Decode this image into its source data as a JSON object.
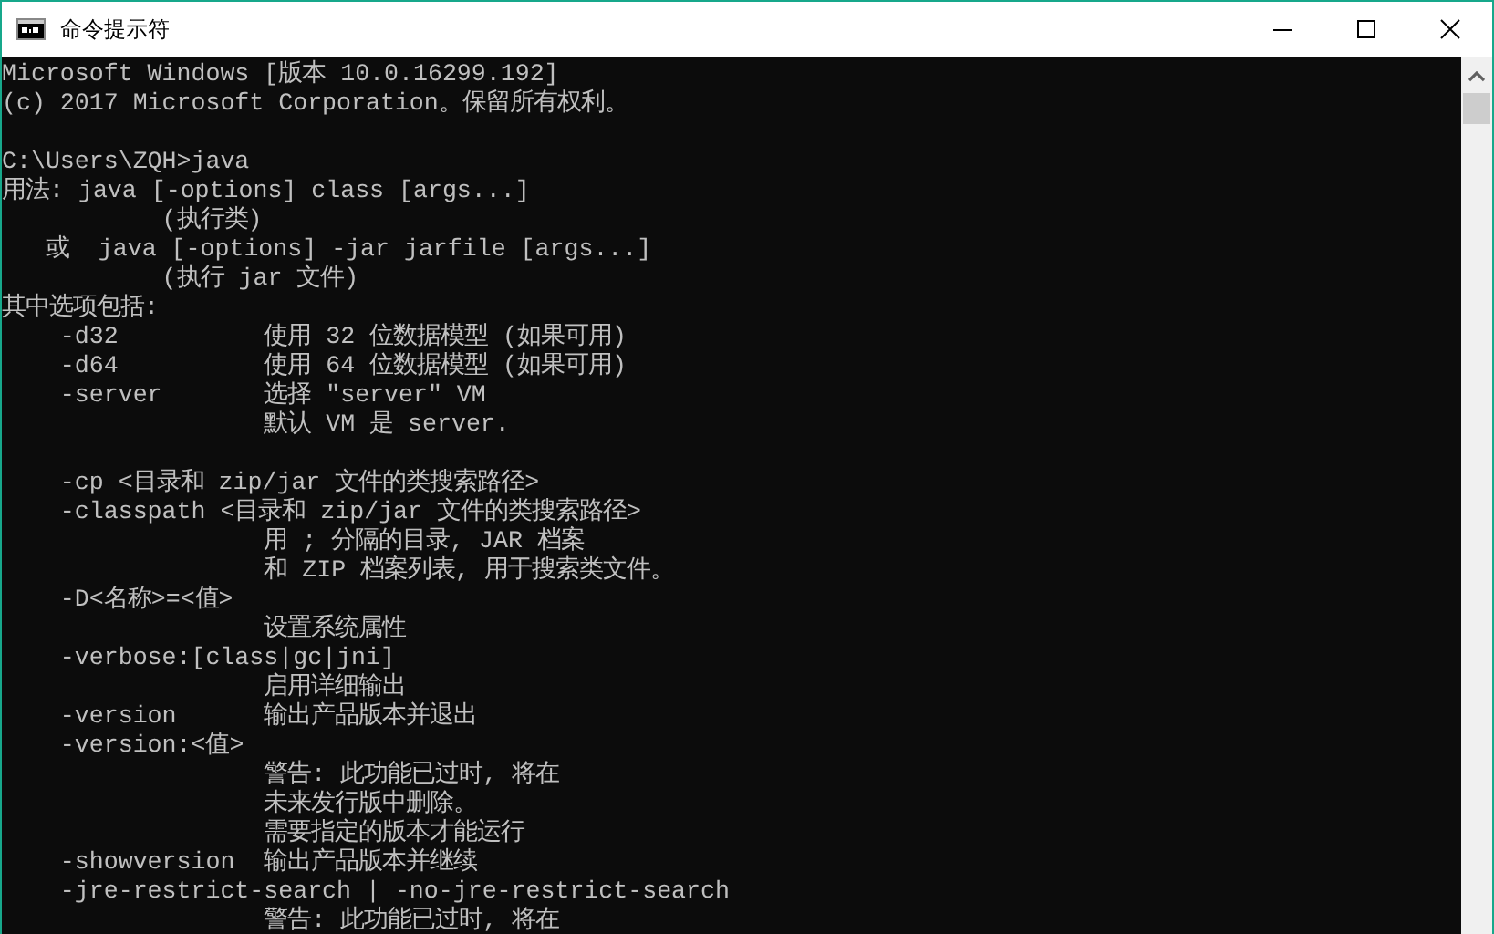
{
  "window": {
    "title": "命令提示符"
  },
  "console": {
    "blocks": [
      [
        "Microsoft Windows [版本 10.0.16299.192]",
        "(c) 2017 Microsoft Corporation。保留所有权利。"
      ],
      [
        "C:\\Users\\ZQH>java",
        "用法: java [-options] class [args...]",
        "           (执行类)",
        "   或  java [-options] -jar jarfile [args...]",
        "           (执行 jar 文件)",
        "其中选项包括:",
        "    -d32          使用 32 位数据模型 (如果可用)",
        "    -d64          使用 64 位数据模型 (如果可用)",
        "    -server       选择 \"server\" VM",
        "                  默认 VM 是 server."
      ],
      [
        "    -cp <目录和 zip/jar 文件的类搜索路径>",
        "    -classpath <目录和 zip/jar 文件的类搜索路径>",
        "                  用 ; 分隔的目录, JAR 档案",
        "                  和 ZIP 档案列表, 用于搜索类文件。",
        "    -D<名称>=<值>",
        "                  设置系统属性",
        "    -verbose:[class|gc|jni]",
        "                  启用详细输出",
        "    -version      输出产品版本并退出",
        "    -version:<值>",
        "                  警告: 此功能已过时, 将在",
        "                  未来发行版中删除。",
        "                  需要指定的版本才能运行",
        "    -showversion  输出产品版本并继续",
        "    -jre-restrict-search | -no-jre-restrict-search",
        "                  警告: 此功能已过时, 将在"
      ]
    ]
  }
}
